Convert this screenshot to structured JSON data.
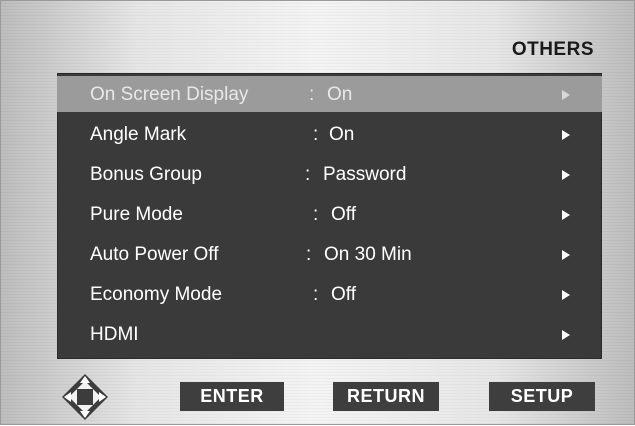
{
  "header": {
    "title": "OTHERS"
  },
  "menu": {
    "items": [
      {
        "label": "On Screen Display",
        "colon": ":",
        "value": "On",
        "highlighted": true
      },
      {
        "label": "Angle Mark",
        "colon": ":",
        "value": "On",
        "highlighted": false
      },
      {
        "label": "Bonus Group",
        "colon": ":",
        "value": "Password",
        "highlighted": false
      },
      {
        "label": "Pure Mode",
        "colon": ":",
        "value": "Off",
        "highlighted": false
      },
      {
        "label": "Auto Power Off",
        "colon": ":",
        "value": "On 30 Min",
        "highlighted": false
      },
      {
        "label": "Economy Mode",
        "colon": ":",
        "value": "Off",
        "highlighted": false
      },
      {
        "label": "HDMI",
        "colon": "",
        "value": "",
        "highlighted": false
      }
    ]
  },
  "footer": {
    "nav_icon": "direction-pad-icon",
    "enter_label": "ENTER",
    "return_label": "RETURN",
    "setup_label": "SETUP"
  },
  "colors": {
    "panel": "#3a3a3a",
    "highlight": "#9b9b9b",
    "button": "#3e3e3e"
  }
}
